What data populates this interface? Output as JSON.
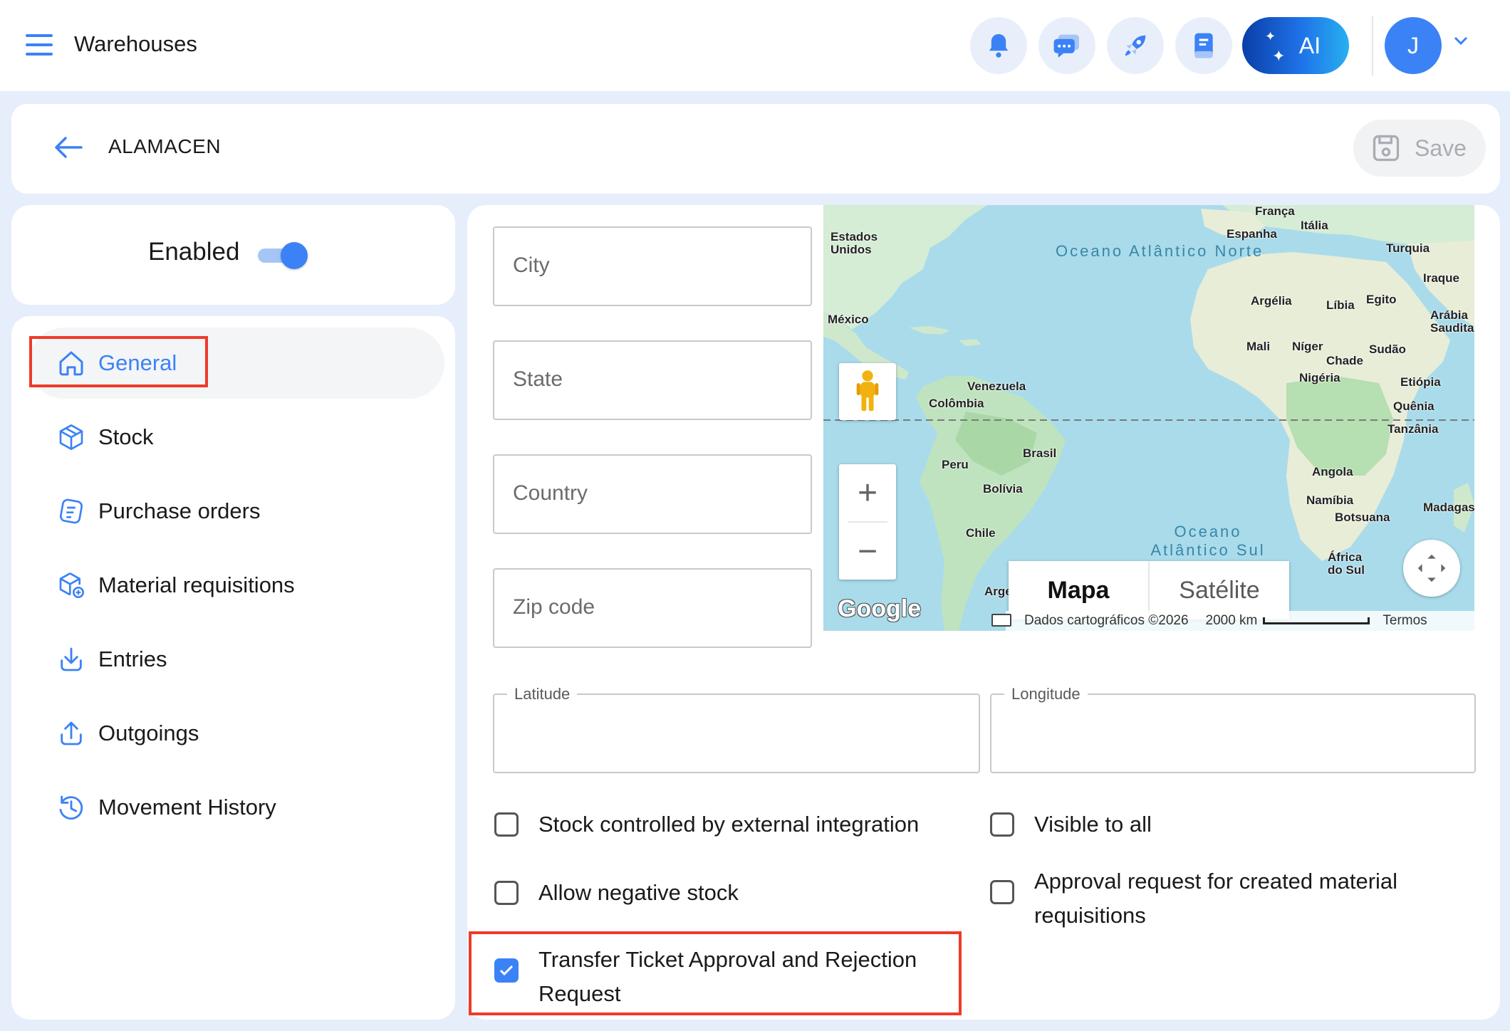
{
  "topbar": {
    "title": "Warehouses",
    "icons": [
      "bell-icon",
      "chat-icon",
      "rocket-icon",
      "book-icon"
    ],
    "ai_label": "AI",
    "avatar_initial": "J"
  },
  "header": {
    "title": "ALAMACEN",
    "save_label": "Save"
  },
  "status": {
    "enabled_label": "Enabled",
    "enabled": true
  },
  "sidebar": {
    "items": [
      {
        "label": "General",
        "icon": "home-icon",
        "active": true
      },
      {
        "label": "Stock",
        "icon": "box-icon",
        "active": false
      },
      {
        "label": "Purchase orders",
        "icon": "purchase-order-icon",
        "active": false
      },
      {
        "label": "Material requisitions",
        "icon": "material-requisition-icon",
        "active": false
      },
      {
        "label": "Entries",
        "icon": "download-icon",
        "active": false
      },
      {
        "label": "Outgoings",
        "icon": "upload-icon",
        "active": false
      },
      {
        "label": "Movement History",
        "icon": "history-icon",
        "active": false
      }
    ]
  },
  "form": {
    "city_placeholder": "City",
    "state_placeholder": "State",
    "country_placeholder": "Country",
    "zip_placeholder": "Zip code",
    "latitude_label": "Latitude",
    "longitude_label": "Longitude",
    "latitude_value": "",
    "longitude_value": ""
  },
  "map": {
    "type_map": "Mapa",
    "type_satellite": "Satélite",
    "google": "Google",
    "attribution": "Dados cartográficos ©2026",
    "scale": "2000 km",
    "terms": "Termos",
    "ocean_north": "Oceano Atlântico Norte",
    "ocean_south": "Oceano Atlântico Sul",
    "labels": {
      "estados_unidos": "Estados Unidos",
      "mexico": "México",
      "venezuela": "Venezuela",
      "colombia": "Colômbia",
      "brasil": "Brasil",
      "peru": "Peru",
      "bolivia": "Bolívia",
      "chile": "Chile",
      "arg": "Arge",
      "franca": "França",
      "espanha": "Espanha",
      "italia": "Itália",
      "turquia": "Turquia",
      "iraque": "Iraque",
      "argelia": "Argélia",
      "libia": "Líbia",
      "egito": "Egito",
      "arabia": "Arábia Saudita",
      "mali": "Mali",
      "niger": "Níger",
      "sudao": "Sudão",
      "chade": "Chade",
      "nigeria": "Nigéria",
      "etiopia": "Etiópia",
      "quenia": "Quênia",
      "tanzania": "Tanzânia",
      "angola": "Angola",
      "namibia": "Namíbia",
      "botsuana": "Botsuana",
      "madagascar": "Madagas",
      "africa_sul": "África do Sul"
    }
  },
  "options": {
    "stock_external": {
      "label": "Stock controlled by external integration",
      "checked": false
    },
    "visible_all": {
      "label": "Visible to all",
      "checked": false
    },
    "allow_negative": {
      "label": "Allow negative stock",
      "checked": false
    },
    "approval_request": {
      "label": "Approval request for created material requisitions",
      "checked": false
    },
    "transfer_ticket": {
      "label": "Transfer Ticket Approval and Rejection Request",
      "checked": true
    }
  },
  "colors": {
    "accent": "#3b82f6",
    "highlight": "#ef3b2a",
    "background": "#e6eefb"
  }
}
